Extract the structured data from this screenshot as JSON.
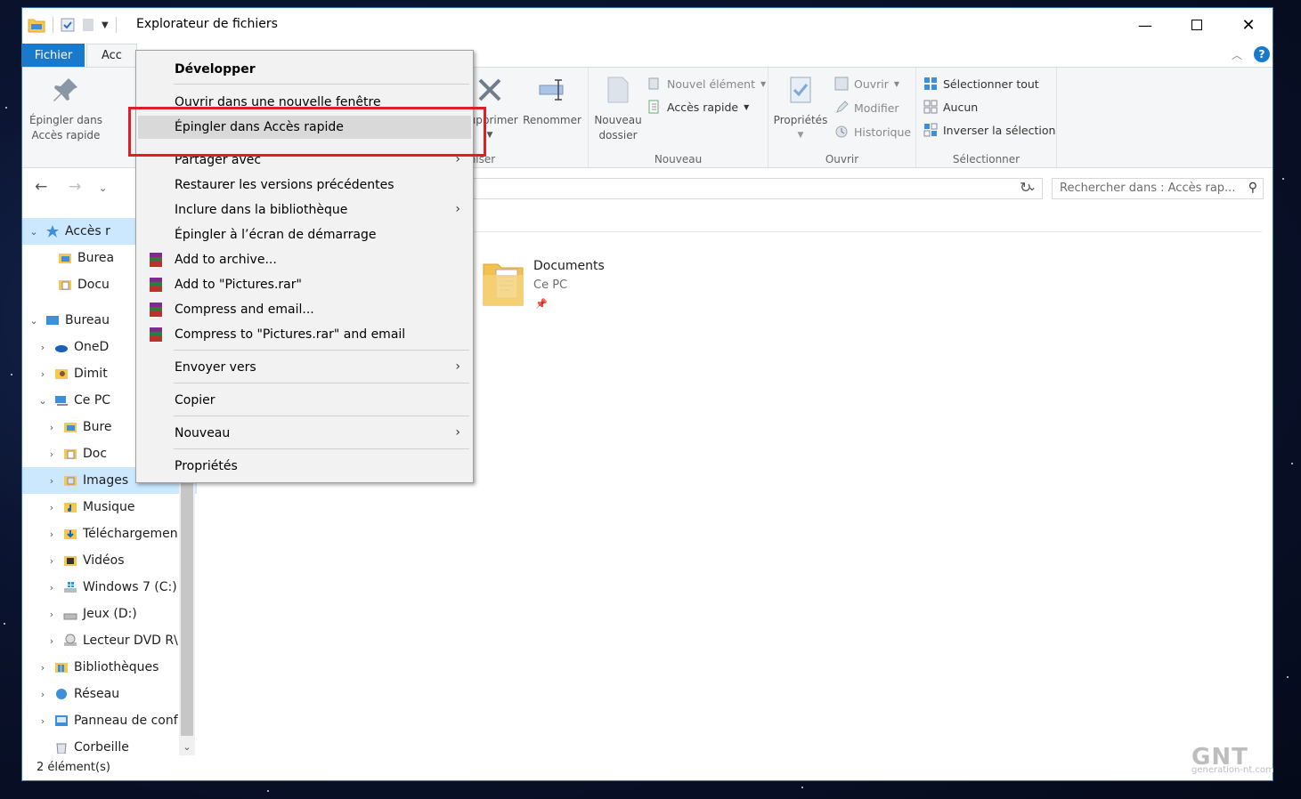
{
  "window": {
    "title": "Explorateur de fichiers"
  },
  "ribbon_tabs": {
    "file": "Fichier",
    "partial": "Acc"
  },
  "ribbon": {
    "pin_label_line1": "Épingler dans",
    "pin_label_line2": "Accès rapide",
    "delete_label": "Supprimer",
    "rename_label": "Renommer",
    "organise_partial": "rganiser",
    "new_folder_line1": "Nouveau",
    "new_folder_line2": "dossier",
    "new_item": "Nouvel élément",
    "quick_access": "Accès rapide",
    "group_new": "Nouveau",
    "properties": "Propriétés",
    "open": "Ouvrir",
    "edit": "Modifier",
    "history": "Historique",
    "group_open": "Ouvrir",
    "select_all": "Sélectionner tout",
    "select_none": "Aucun",
    "invert_selection": "Inverser la sélection",
    "group_select": "Sélectionner"
  },
  "search": {
    "placeholder": "Rechercher dans : Accès rap..."
  },
  "nav": {
    "items": [
      {
        "label": "Accès r"
      },
      {
        "label": "Burea"
      },
      {
        "label": "Docu"
      },
      {
        "label": "Bureau"
      },
      {
        "label": "OneD"
      },
      {
        "label": "Dimit"
      },
      {
        "label": "Ce PC"
      },
      {
        "label": "Bure"
      },
      {
        "label": "Doc"
      },
      {
        "label": "Images"
      },
      {
        "label": "Musique"
      },
      {
        "label": "Téléchargemen"
      },
      {
        "label": "Vidéos"
      },
      {
        "label": "Windows 7 (C:)"
      },
      {
        "label": "Jeux (D:)"
      },
      {
        "label": "Lecteur DVD R\\"
      },
      {
        "label": "Bibliothèques"
      },
      {
        "label": "Réseau"
      },
      {
        "label": "Panneau de conf"
      },
      {
        "label": "Corbeille"
      }
    ]
  },
  "content": {
    "tile_name": "Documents",
    "tile_location": "Ce PC"
  },
  "status": {
    "count": "2 élément(s)"
  },
  "context_menu": {
    "expand": "Développer",
    "open_new_window": "Ouvrir dans une nouvelle fenêtre",
    "pin_quick_access": "Épingler dans Accès rapide",
    "share_with": "Partager avec",
    "restore_versions": "Restaurer les versions précédentes",
    "include_library": "Inclure dans la bibliothèque",
    "pin_start": "Épingler à l’écran de démarrage",
    "add_archive": "Add to archive...",
    "add_rar": "Add to \"Pictures.rar\"",
    "compress_email": "Compress and email...",
    "compress_rar_email": "Compress to \"Pictures.rar\" and email",
    "send_to": "Envoyer vers",
    "copy": "Copier",
    "new": "Nouveau",
    "properties": "Propriétés"
  },
  "watermark": {
    "brand": "GNT",
    "site": "generation-nt.com"
  },
  "colors": {
    "accent": "#1979ca",
    "highlight_box": "#e01e25",
    "selection": "#cce8ff"
  }
}
